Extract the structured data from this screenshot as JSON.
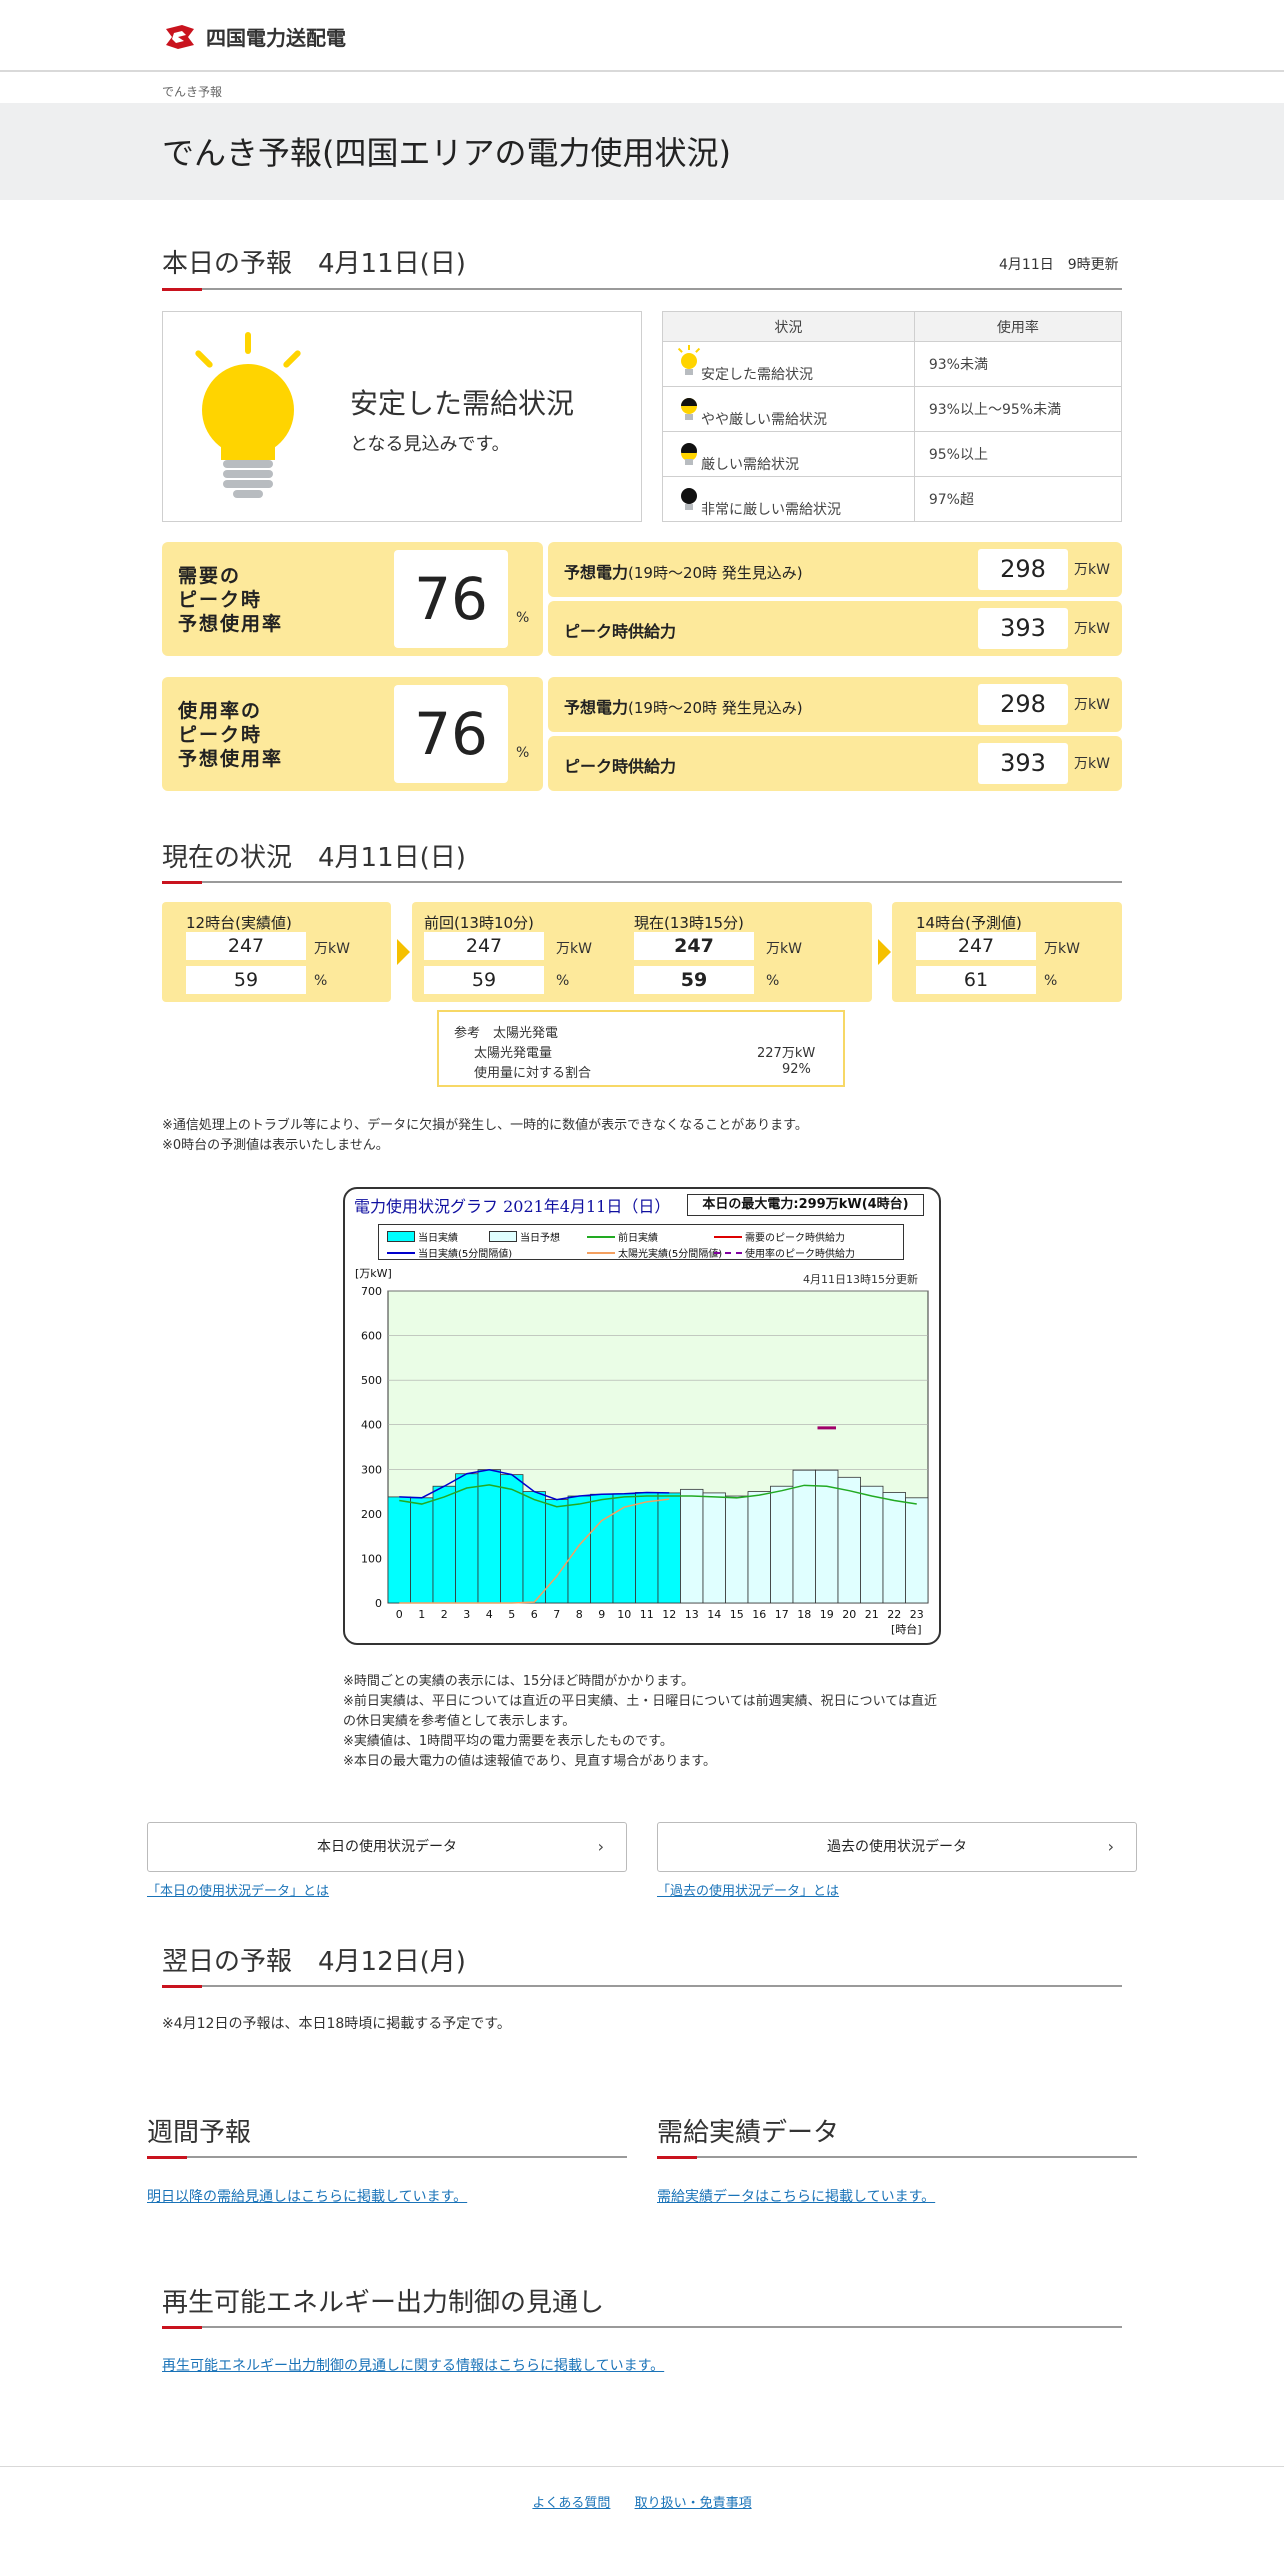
{
  "header": {
    "logo_text": "四国電力送配電",
    "breadcrumb": "でんき予報"
  },
  "page_title": "でんき予報(四国エリアの電力使用状況)",
  "today": {
    "title": "本日の予報　4月11日(日)",
    "update": "4月11日　9時更新",
    "status_main": "安定した需給状況",
    "status_sub": "となる見込みです。",
    "legend_headers": [
      "状況",
      "使用率"
    ],
    "legend": [
      {
        "status": "安定した需給状況",
        "rate": "93%未満",
        "color": "#ffd400"
      },
      {
        "status": "やや厳しい需給状況",
        "rate": "93%以上～95%未満",
        "color": "#ffd400"
      },
      {
        "status": "厳しい需給状況",
        "rate": "95%以上",
        "color": "#ffd400"
      },
      {
        "status": "非常に厳しい需給状況",
        "rate": "97%超",
        "color": "#111111"
      }
    ],
    "blocks": [
      {
        "label_l1": "需要の",
        "label_l2": "ピーク時",
        "label_l3": "予想使用率",
        "value": "76",
        "unit": "%",
        "row1_label": "予想電力",
        "row1_label_sub": "(19時～20時 発生見込み)",
        "row1_value": "298",
        "row1_unit": "万kW",
        "row2_label": "ピーク時供給力",
        "row2_value": "393",
        "row2_unit": "万kW"
      },
      {
        "label_l1": "使用率の",
        "label_l2": "ピーク時",
        "label_l3": "予想使用率",
        "value": "76",
        "unit": "%",
        "row1_label": "予想電力",
        "row1_label_sub": "(19時～20時 発生見込み)",
        "row1_value": "298",
        "row1_unit": "万kW",
        "row2_label": "ピーク時供給力",
        "row2_value": "393",
        "row2_unit": "万kW"
      }
    ]
  },
  "current": {
    "title": "現在の状況　4月11日(日)",
    "col1_label": "12時台(実績値)",
    "col1_kw": "247",
    "col1_pct": "59",
    "col2_label": "前回(13時10分)",
    "col2_kw": "247",
    "col2_pct": "59",
    "col3_label": "現在(13時15分)",
    "col3_kw": "247",
    "col3_pct": "59",
    "col4_label": "14時台(予測値)",
    "col4_kw": "247",
    "col4_pct": "61",
    "unit_kw": "万kW",
    "unit_pct": "%",
    "solar_title": "参考　太陽光発電",
    "solar_row1_label": "太陽光発電量",
    "solar_row1_value": "227万kW",
    "solar_row2_label": "使用量に対する割合",
    "solar_row2_value": "92%"
  },
  "notes1": [
    "※通信処理上のトラブル等により、データに欠損が発生し、一時的に数値が表示できなくなることがあります。",
    "※0時台の予測値は表示いたしません。"
  ],
  "chart_data": {
    "type": "bar",
    "title": "電力使用状況グラフ 2021年4月11日（日）",
    "max_label": "本日の最大電力:299万kW(4時台)",
    "update": "4月11日13時15分更新",
    "ylabel": "[万kW]",
    "xlabel": "[時台]",
    "ylim": [
      0,
      700
    ],
    "yticks": [
      0,
      100,
      200,
      300,
      400,
      500,
      600,
      700
    ],
    "categories": [
      "0",
      "1",
      "2",
      "3",
      "4",
      "5",
      "6",
      "7",
      "8",
      "9",
      "10",
      "11",
      "12",
      "13",
      "14",
      "15",
      "16",
      "17",
      "18",
      "19",
      "20",
      "21",
      "22",
      "23"
    ],
    "legend": [
      "当日実績",
      "当日予想",
      "前日実績",
      "需要のピーク時供給力",
      "当日実績(5分間隔値)",
      "太陽光実績(5分間隔値)",
      "使用率のピーク時供給力"
    ],
    "series": [
      {
        "name": "当日実績",
        "color": "#00ffff",
        "values": [
          238,
          236,
          262,
          290,
          299,
          288,
          250,
          232,
          240,
          244,
          245,
          248,
          247,
          null,
          null,
          null,
          null,
          null,
          null,
          null,
          null,
          null,
          null,
          null
        ]
      },
      {
        "name": "当日予想",
        "color": "#e0ffff",
        "values": [
          null,
          null,
          null,
          null,
          null,
          null,
          null,
          null,
          null,
          null,
          null,
          null,
          null,
          255,
          247,
          240,
          250,
          262,
          298,
          298,
          282,
          262,
          248,
          236
        ]
      },
      {
        "name": "前日実績",
        "color": "#22aa22",
        "values": [
          230,
          222,
          238,
          258,
          265,
          255,
          232,
          216,
          222,
          232,
          238,
          240,
          240,
          240,
          238,
          236,
          242,
          252,
          264,
          262,
          252,
          240,
          230,
          222
        ]
      },
      {
        "name": "太陽光実績(5分間隔値)",
        "color": "#f4a060",
        "values": [
          0,
          0,
          0,
          0,
          0,
          0,
          2,
          60,
          130,
          185,
          215,
          227,
          233
        ]
      },
      {
        "name": "需要のピーク時供給力",
        "color": "#a0006a",
        "values": [
          null,
          null,
          null,
          null,
          null,
          null,
          null,
          null,
          null,
          null,
          null,
          null,
          null,
          null,
          null,
          null,
          null,
          null,
          null,
          393,
          null,
          null,
          null,
          null
        ]
      }
    ]
  },
  "notes2": [
    "※時間ごとの実績の表示には、15分ほど時間がかかります。",
    "※前日実績は、平日については直近の平日実績、土・日曜日については前週実績、祝日については直近",
    "の休日実績を参考値として表示します。",
    "※実績値は、1時間平均の電力需要を表示したものです。",
    "※本日の最大電力の値は速報値であり、見直す場合があります。"
  ],
  "buttons": {
    "today_data": "本日の使用状況データ",
    "past_data": "過去の使用状況データ",
    "today_link": "「本日の使用状況データ」とは",
    "past_link": "「過去の使用状況データ」とは",
    "chevron": "›"
  },
  "tomorrow": {
    "title": "翌日の予報　4月12日(月)",
    "note": "※4月12日の予報は、本日18時頃に掲載する予定です。"
  },
  "weekly": {
    "title": "週間予報",
    "link": "明日以降の需給見通しはこちらに掲載しています。"
  },
  "supply": {
    "title": "需給実績データ",
    "link": "需給実績データはこちらに掲載しています。"
  },
  "renewable": {
    "title": "再生可能エネルギー出力制御の見通し",
    "link": "再生可能エネルギー出力制御の見通しに関する情報はこちらに掲載しています。"
  },
  "footer": {
    "faq": "よくある質問",
    "terms": "取り扱い・免責事項"
  }
}
